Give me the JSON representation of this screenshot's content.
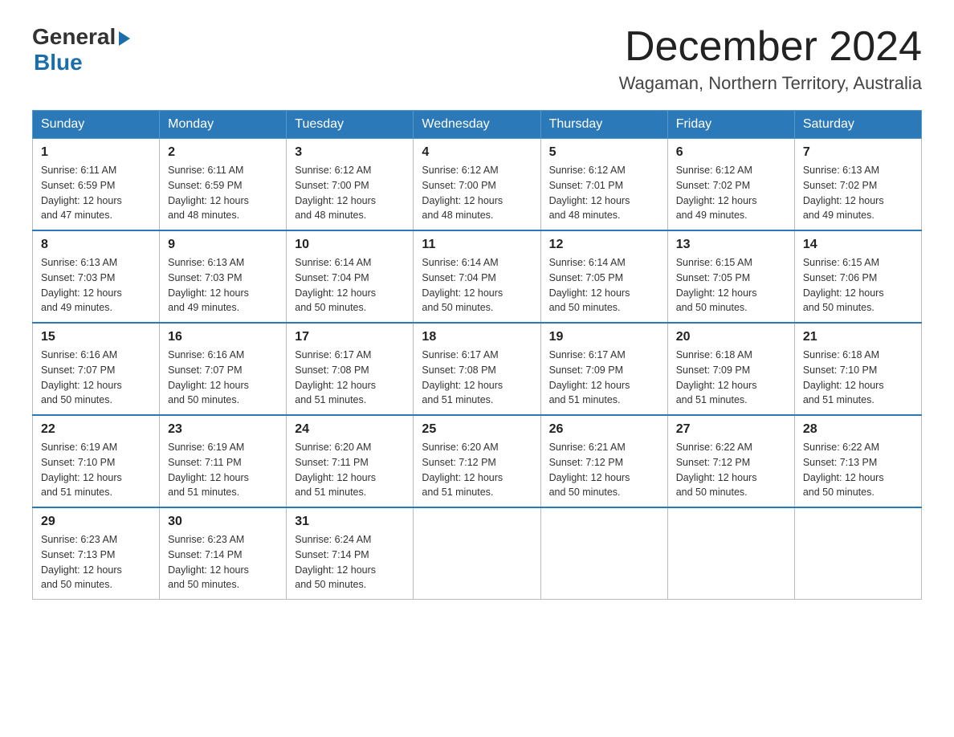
{
  "header": {
    "logo_general": "General",
    "logo_blue": "Blue",
    "month_title": "December 2024",
    "location": "Wagaman, Northern Territory, Australia"
  },
  "days_of_week": [
    "Sunday",
    "Monday",
    "Tuesday",
    "Wednesday",
    "Thursday",
    "Friday",
    "Saturday"
  ],
  "weeks": [
    [
      {
        "num": "1",
        "sunrise": "6:11 AM",
        "sunset": "6:59 PM",
        "daylight": "12 hours and 47 minutes."
      },
      {
        "num": "2",
        "sunrise": "6:11 AM",
        "sunset": "6:59 PM",
        "daylight": "12 hours and 48 minutes."
      },
      {
        "num": "3",
        "sunrise": "6:12 AM",
        "sunset": "7:00 PM",
        "daylight": "12 hours and 48 minutes."
      },
      {
        "num": "4",
        "sunrise": "6:12 AM",
        "sunset": "7:00 PM",
        "daylight": "12 hours and 48 minutes."
      },
      {
        "num": "5",
        "sunrise": "6:12 AM",
        "sunset": "7:01 PM",
        "daylight": "12 hours and 48 minutes."
      },
      {
        "num": "6",
        "sunrise": "6:12 AM",
        "sunset": "7:02 PM",
        "daylight": "12 hours and 49 minutes."
      },
      {
        "num": "7",
        "sunrise": "6:13 AM",
        "sunset": "7:02 PM",
        "daylight": "12 hours and 49 minutes."
      }
    ],
    [
      {
        "num": "8",
        "sunrise": "6:13 AM",
        "sunset": "7:03 PM",
        "daylight": "12 hours and 49 minutes."
      },
      {
        "num": "9",
        "sunrise": "6:13 AM",
        "sunset": "7:03 PM",
        "daylight": "12 hours and 49 minutes."
      },
      {
        "num": "10",
        "sunrise": "6:14 AM",
        "sunset": "7:04 PM",
        "daylight": "12 hours and 50 minutes."
      },
      {
        "num": "11",
        "sunrise": "6:14 AM",
        "sunset": "7:04 PM",
        "daylight": "12 hours and 50 minutes."
      },
      {
        "num": "12",
        "sunrise": "6:14 AM",
        "sunset": "7:05 PM",
        "daylight": "12 hours and 50 minutes."
      },
      {
        "num": "13",
        "sunrise": "6:15 AM",
        "sunset": "7:05 PM",
        "daylight": "12 hours and 50 minutes."
      },
      {
        "num": "14",
        "sunrise": "6:15 AM",
        "sunset": "7:06 PM",
        "daylight": "12 hours and 50 minutes."
      }
    ],
    [
      {
        "num": "15",
        "sunrise": "6:16 AM",
        "sunset": "7:07 PM",
        "daylight": "12 hours and 50 minutes."
      },
      {
        "num": "16",
        "sunrise": "6:16 AM",
        "sunset": "7:07 PM",
        "daylight": "12 hours and 50 minutes."
      },
      {
        "num": "17",
        "sunrise": "6:17 AM",
        "sunset": "7:08 PM",
        "daylight": "12 hours and 51 minutes."
      },
      {
        "num": "18",
        "sunrise": "6:17 AM",
        "sunset": "7:08 PM",
        "daylight": "12 hours and 51 minutes."
      },
      {
        "num": "19",
        "sunrise": "6:17 AM",
        "sunset": "7:09 PM",
        "daylight": "12 hours and 51 minutes."
      },
      {
        "num": "20",
        "sunrise": "6:18 AM",
        "sunset": "7:09 PM",
        "daylight": "12 hours and 51 minutes."
      },
      {
        "num": "21",
        "sunrise": "6:18 AM",
        "sunset": "7:10 PM",
        "daylight": "12 hours and 51 minutes."
      }
    ],
    [
      {
        "num": "22",
        "sunrise": "6:19 AM",
        "sunset": "7:10 PM",
        "daylight": "12 hours and 51 minutes."
      },
      {
        "num": "23",
        "sunrise": "6:19 AM",
        "sunset": "7:11 PM",
        "daylight": "12 hours and 51 minutes."
      },
      {
        "num": "24",
        "sunrise": "6:20 AM",
        "sunset": "7:11 PM",
        "daylight": "12 hours and 51 minutes."
      },
      {
        "num": "25",
        "sunrise": "6:20 AM",
        "sunset": "7:12 PM",
        "daylight": "12 hours and 51 minutes."
      },
      {
        "num": "26",
        "sunrise": "6:21 AM",
        "sunset": "7:12 PM",
        "daylight": "12 hours and 50 minutes."
      },
      {
        "num": "27",
        "sunrise": "6:22 AM",
        "sunset": "7:12 PM",
        "daylight": "12 hours and 50 minutes."
      },
      {
        "num": "28",
        "sunrise": "6:22 AM",
        "sunset": "7:13 PM",
        "daylight": "12 hours and 50 minutes."
      }
    ],
    [
      {
        "num": "29",
        "sunrise": "6:23 AM",
        "sunset": "7:13 PM",
        "daylight": "12 hours and 50 minutes."
      },
      {
        "num": "30",
        "sunrise": "6:23 AM",
        "sunset": "7:14 PM",
        "daylight": "12 hours and 50 minutes."
      },
      {
        "num": "31",
        "sunrise": "6:24 AM",
        "sunset": "7:14 PM",
        "daylight": "12 hours and 50 minutes."
      },
      null,
      null,
      null,
      null
    ]
  ],
  "labels": {
    "sunrise_prefix": "Sunrise: ",
    "sunset_prefix": "Sunset: ",
    "daylight_prefix": "Daylight: "
  }
}
